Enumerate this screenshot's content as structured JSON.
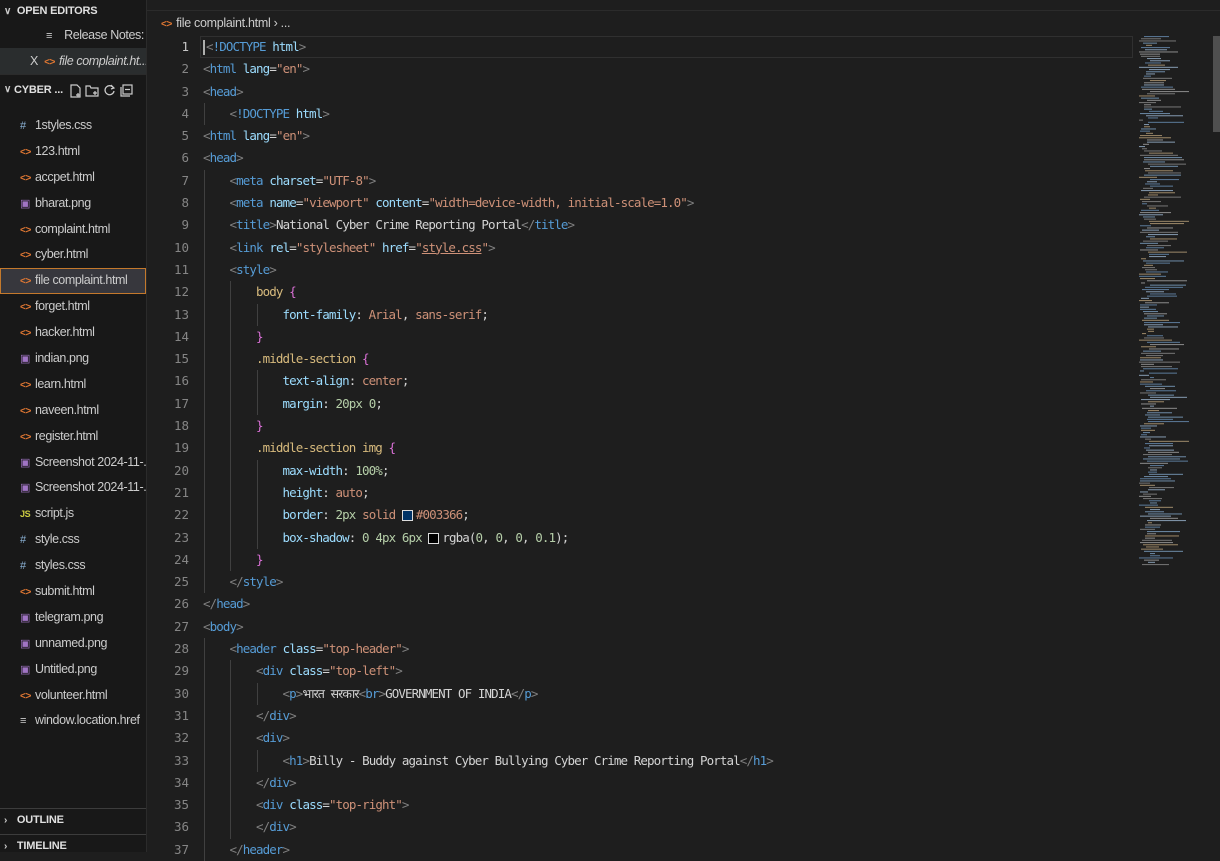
{
  "sidebar": {
    "open_editors": {
      "title": "OPEN EDITORS",
      "items": [
        {
          "label": "Release Notes: 1...",
          "icon": "notes-icon"
        },
        {
          "label": "file complaint.ht...",
          "icon": "html-file-icon",
          "close": "X"
        }
      ]
    },
    "explorer": {
      "title": "CYBER ...",
      "toolbar": [
        "new-file-icon",
        "new-folder-icon",
        "refresh-icon",
        "collapse-all-icon"
      ],
      "files": [
        {
          "label": "1styles.css",
          "type": "css",
          "glyph": "#"
        },
        {
          "label": "123.html",
          "type": "html",
          "glyph": "<>"
        },
        {
          "label": "accpet.html",
          "type": "html",
          "glyph": "<>"
        },
        {
          "label": "bharat.png",
          "type": "png",
          "glyph": "▣"
        },
        {
          "label": "complaint.html",
          "type": "html",
          "glyph": "<>"
        },
        {
          "label": "cyber.html",
          "type": "html",
          "glyph": "<>"
        },
        {
          "label": "file complaint.html",
          "type": "html",
          "glyph": "<>",
          "active": true
        },
        {
          "label": "forget.html",
          "type": "html",
          "glyph": "<>"
        },
        {
          "label": "hacker.html",
          "type": "html",
          "glyph": "<>"
        },
        {
          "label": "indian.png",
          "type": "png",
          "glyph": "▣"
        },
        {
          "label": "learn.html",
          "type": "html",
          "glyph": "<>"
        },
        {
          "label": "naveen.html",
          "type": "html",
          "glyph": "<>"
        },
        {
          "label": "register.html",
          "type": "html",
          "glyph": "<>"
        },
        {
          "label": "Screenshot 2024-11-...",
          "type": "png",
          "glyph": "▣"
        },
        {
          "label": "Screenshot 2024-11-...",
          "type": "png",
          "glyph": "▣"
        },
        {
          "label": "script.js",
          "type": "js",
          "glyph": "JS"
        },
        {
          "label": "style.css",
          "type": "css",
          "glyph": "#"
        },
        {
          "label": "styles.css",
          "type": "css",
          "glyph": "#"
        },
        {
          "label": "submit.html",
          "type": "html",
          "glyph": "<>"
        },
        {
          "label": "telegram.png",
          "type": "png",
          "glyph": "▣"
        },
        {
          "label": "unnamed.png",
          "type": "png",
          "glyph": "▣"
        },
        {
          "label": "Untitled.png",
          "type": "png",
          "glyph": "▣"
        },
        {
          "label": "volunteer.html",
          "type": "html",
          "glyph": "<>"
        },
        {
          "label": "window.location.href",
          "type": "txt",
          "glyph": "≡"
        }
      ]
    },
    "outline_title": "OUTLINE",
    "timeline_title": "TIMELINE"
  },
  "editor": {
    "breadcrumb": "file complaint.html",
    "breadcrumb_more": "...",
    "current_line": 1,
    "line_numbers": [
      "1",
      "2",
      "3",
      "4",
      "5",
      "6",
      "7",
      "8",
      "9",
      "10",
      "11",
      "12",
      "13",
      "14",
      "15",
      "16",
      "17",
      "18",
      "19",
      "20",
      "21",
      "22",
      "23",
      "24",
      "25",
      "26",
      "27",
      "28",
      "29",
      "30",
      "31",
      "32",
      "33",
      "34",
      "35",
      "36",
      "37"
    ],
    "code_lines": [
      "<!DOCTYPE html>",
      "<html lang=\"en\">",
      "<head>",
      "    <!DOCTYPE html>",
      "<html lang=\"en\">",
      "<head>",
      "    <meta charset=\"UTF-8\">",
      "    <meta name=\"viewport\" content=\"width=device-width, initial-scale=1.0\">",
      "    <title>National Cyber Crime Reporting Portal</title>",
      "    <link rel=\"stylesheet\" href=\"style.css\">",
      "    <style>",
      "        body {",
      "            font-family: Arial, sans-serif;",
      "        }",
      "        .middle-section {",
      "            text-align: center;",
      "            margin: 20px 0;",
      "        }",
      "        .middle-section img {",
      "            max-width: 100%;",
      "            height: auto;",
      "            border: 2px solid #003366;",
      "            box-shadow: 0 4px 6px rgba(0, 0, 0, 0.1);",
      "        }",
      "    </style>",
      "</head>",
      "<body>",
      "    <header class=\"top-header\">",
      "        <div class=\"top-left\">",
      "            <p>भारत सरकार<br>GOVERNMENT OF INDIA</p>",
      "        </div>",
      "        <div>",
      "            <h1>Billy - Buddy against Cyber Bullying Cyber Crime Reporting Portal</h1>",
      "        </div>",
      "        <div class=\"top-right\">",
      "        </div>",
      "    </header>"
    ],
    "colors": {
      "swatch_border": "#003366",
      "swatch_shadow": "#000000"
    }
  }
}
